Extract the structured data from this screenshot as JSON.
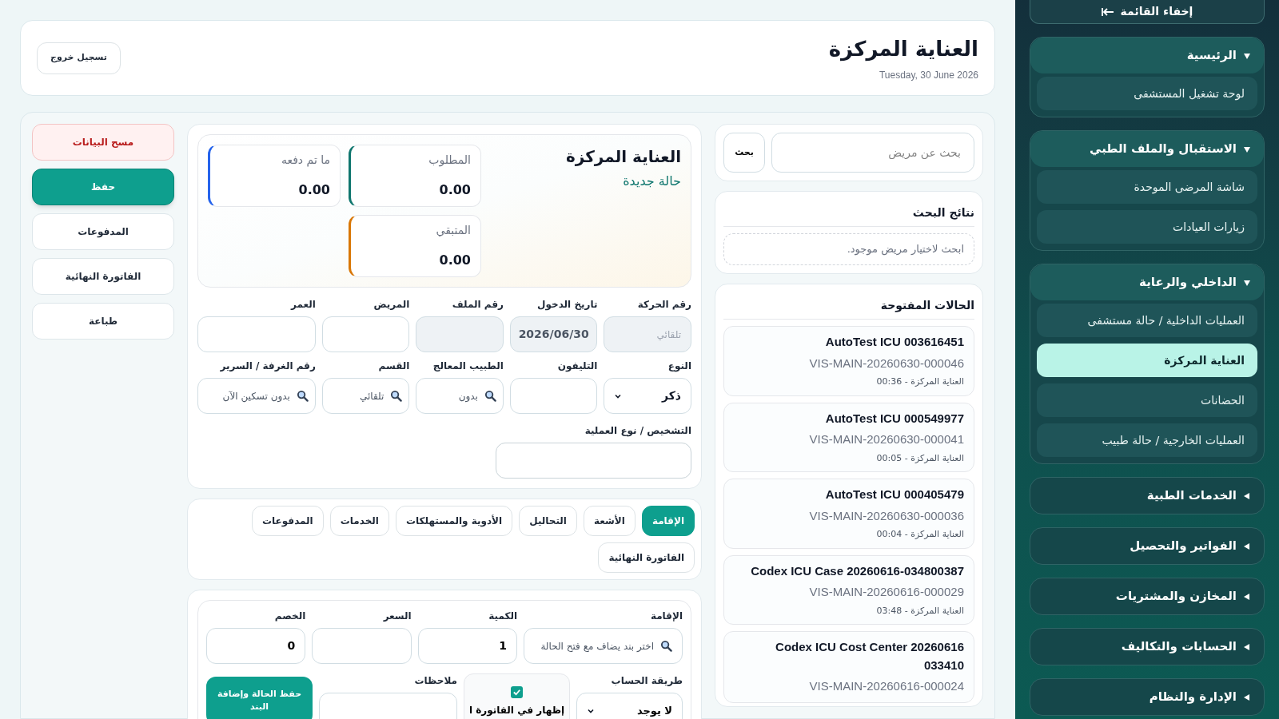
{
  "header": {
    "title": "العناية المركزة",
    "date": "Tuesday, 30 June 2026",
    "logout": "تسجيل خروج"
  },
  "search": {
    "placeholder": "بحث عن مريض",
    "button": "بحث"
  },
  "search_results": {
    "title": "نتائج البحث",
    "empty": "ابحث لاختيار مريض موجود."
  },
  "open_cases": {
    "title": "الحالات المفتوحة",
    "items": [
      {
        "name": "AutoTest ICU 003616451",
        "visit": "VIS-MAIN-20260630-000046",
        "meta": "العناية المركزة - 00:36"
      },
      {
        "name": "AutoTest ICU 000549977",
        "visit": "VIS-MAIN-20260630-000041",
        "meta": "العناية المركزة - 00:05"
      },
      {
        "name": "AutoTest ICU 000405479",
        "visit": "VIS-MAIN-20260630-000036",
        "meta": "العناية المركزة - 00:04"
      },
      {
        "name": "Codex ICU Case 20260616-034800387",
        "visit": "VIS-MAIN-20260616-000029",
        "meta": "العناية المركزة - 03:48"
      },
      {
        "name": "Codex ICU Cost Center 20260616 033410",
        "visit": "VIS-MAIN-20260616-000024"
      }
    ]
  },
  "summary": {
    "title": "العناية المركزة",
    "status": "حالة جديدة",
    "cards": [
      {
        "label": "المطلوب",
        "value": "0.00",
        "color": "#0f766e"
      },
      {
        "label": "ما تم دفعه",
        "value": "0.00",
        "color": "#2563eb"
      },
      {
        "label": "المتبقي",
        "value": "0.00",
        "color": "#d97706"
      }
    ]
  },
  "actions": [
    {
      "label": "مسح البيانات",
      "kind": "danger"
    },
    {
      "label": "حفظ",
      "kind": "primary"
    },
    {
      "label": "المدفوعات",
      "kind": "default"
    },
    {
      "label": "الفاتورة النهائية",
      "kind": "default"
    },
    {
      "label": "طباعة",
      "kind": "default"
    }
  ],
  "fields": [
    {
      "label": "رقم الحركة",
      "kind": "readonly",
      "placeholder": "تلقائي"
    },
    {
      "label": "تاريخ الدخول",
      "kind": "readonly",
      "value": "2026/06/30"
    },
    {
      "label": "رقم الملف",
      "kind": "readonly"
    },
    {
      "label": "المريض",
      "kind": "text"
    },
    {
      "label": "العمر",
      "kind": "text"
    },
    {
      "label": "النوع",
      "kind": "select",
      "value": "ذكر"
    },
    {
      "label": "التليفون",
      "kind": "text"
    },
    {
      "label": "الطبيب المعالج",
      "kind": "lookup",
      "value": "بدون"
    },
    {
      "label": "القسم",
      "kind": "lookup",
      "value": "تلقائي"
    },
    {
      "label": "رقم الغرفة / السرير",
      "kind": "lookup",
      "value": "بدون تسكين الآن"
    }
  ],
  "diagnosis": {
    "label": "التشخيص / نوع العملية"
  },
  "tabs": [
    {
      "label": "الإقامة",
      "selected": true
    },
    {
      "label": "الأشعة",
      "selected": false
    },
    {
      "label": "التحاليل",
      "selected": false
    },
    {
      "label": "الأدوية والمستهلكات",
      "selected": false
    },
    {
      "label": "الخدمات",
      "selected": false
    },
    {
      "label": "المدفوعات",
      "selected": false
    },
    {
      "label": "الفاتورة النهائية",
      "selected": false
    }
  ],
  "item_form": {
    "item": {
      "label": "الإقامة",
      "placeholder": "اختر بند يضاف مع فتح الحالة"
    },
    "quantity": {
      "label": "الكمية",
      "value": "1"
    },
    "price": {
      "label": "السعر"
    },
    "discount": {
      "label": "الخصم",
      "value": "0"
    },
    "method": {
      "label": "طريقة الحساب",
      "value": "لا يوجد"
    },
    "show_in_invoice": {
      "label": "إظهار في الفاتورة ا",
      "checked": true
    },
    "notes": {
      "label": "ملاحظات"
    },
    "submit": "حفظ الحالة وإضافة البند"
  },
  "sidebar": {
    "hide": "إخفاء القائمة",
    "groups": [
      {
        "label": "الرئيسية",
        "expanded": true,
        "items": [
          {
            "label": "لوحة تشغيل المستشفى",
            "selected": false
          }
        ]
      },
      {
        "label": "الاستقبال والملف الطبي",
        "expanded": true,
        "items": [
          {
            "label": "شاشة المرضى الموحدة",
            "selected": false
          },
          {
            "label": "زيارات العيادات",
            "selected": false
          }
        ]
      },
      {
        "label": "الداخلي والرعاية",
        "expanded": true,
        "items": [
          {
            "label": "العمليات الداخلية / حالة مستشفى",
            "selected": false
          },
          {
            "label": "العناية المركزة",
            "selected": true
          },
          {
            "label": "الحضانات",
            "selected": false
          },
          {
            "label": "العمليات الخارجية / حالة طبيب",
            "selected": false
          }
        ]
      },
      {
        "label": "الخدمات الطبية",
        "expanded": false
      },
      {
        "label": "الفواتير والتحصيل",
        "expanded": false
      },
      {
        "label": "المخازن والمشتريات",
        "expanded": false
      },
      {
        "label": "الحسابات والتكاليف",
        "expanded": false
      },
      {
        "label": "الإدارة والنظام",
        "expanded": false
      }
    ]
  }
}
